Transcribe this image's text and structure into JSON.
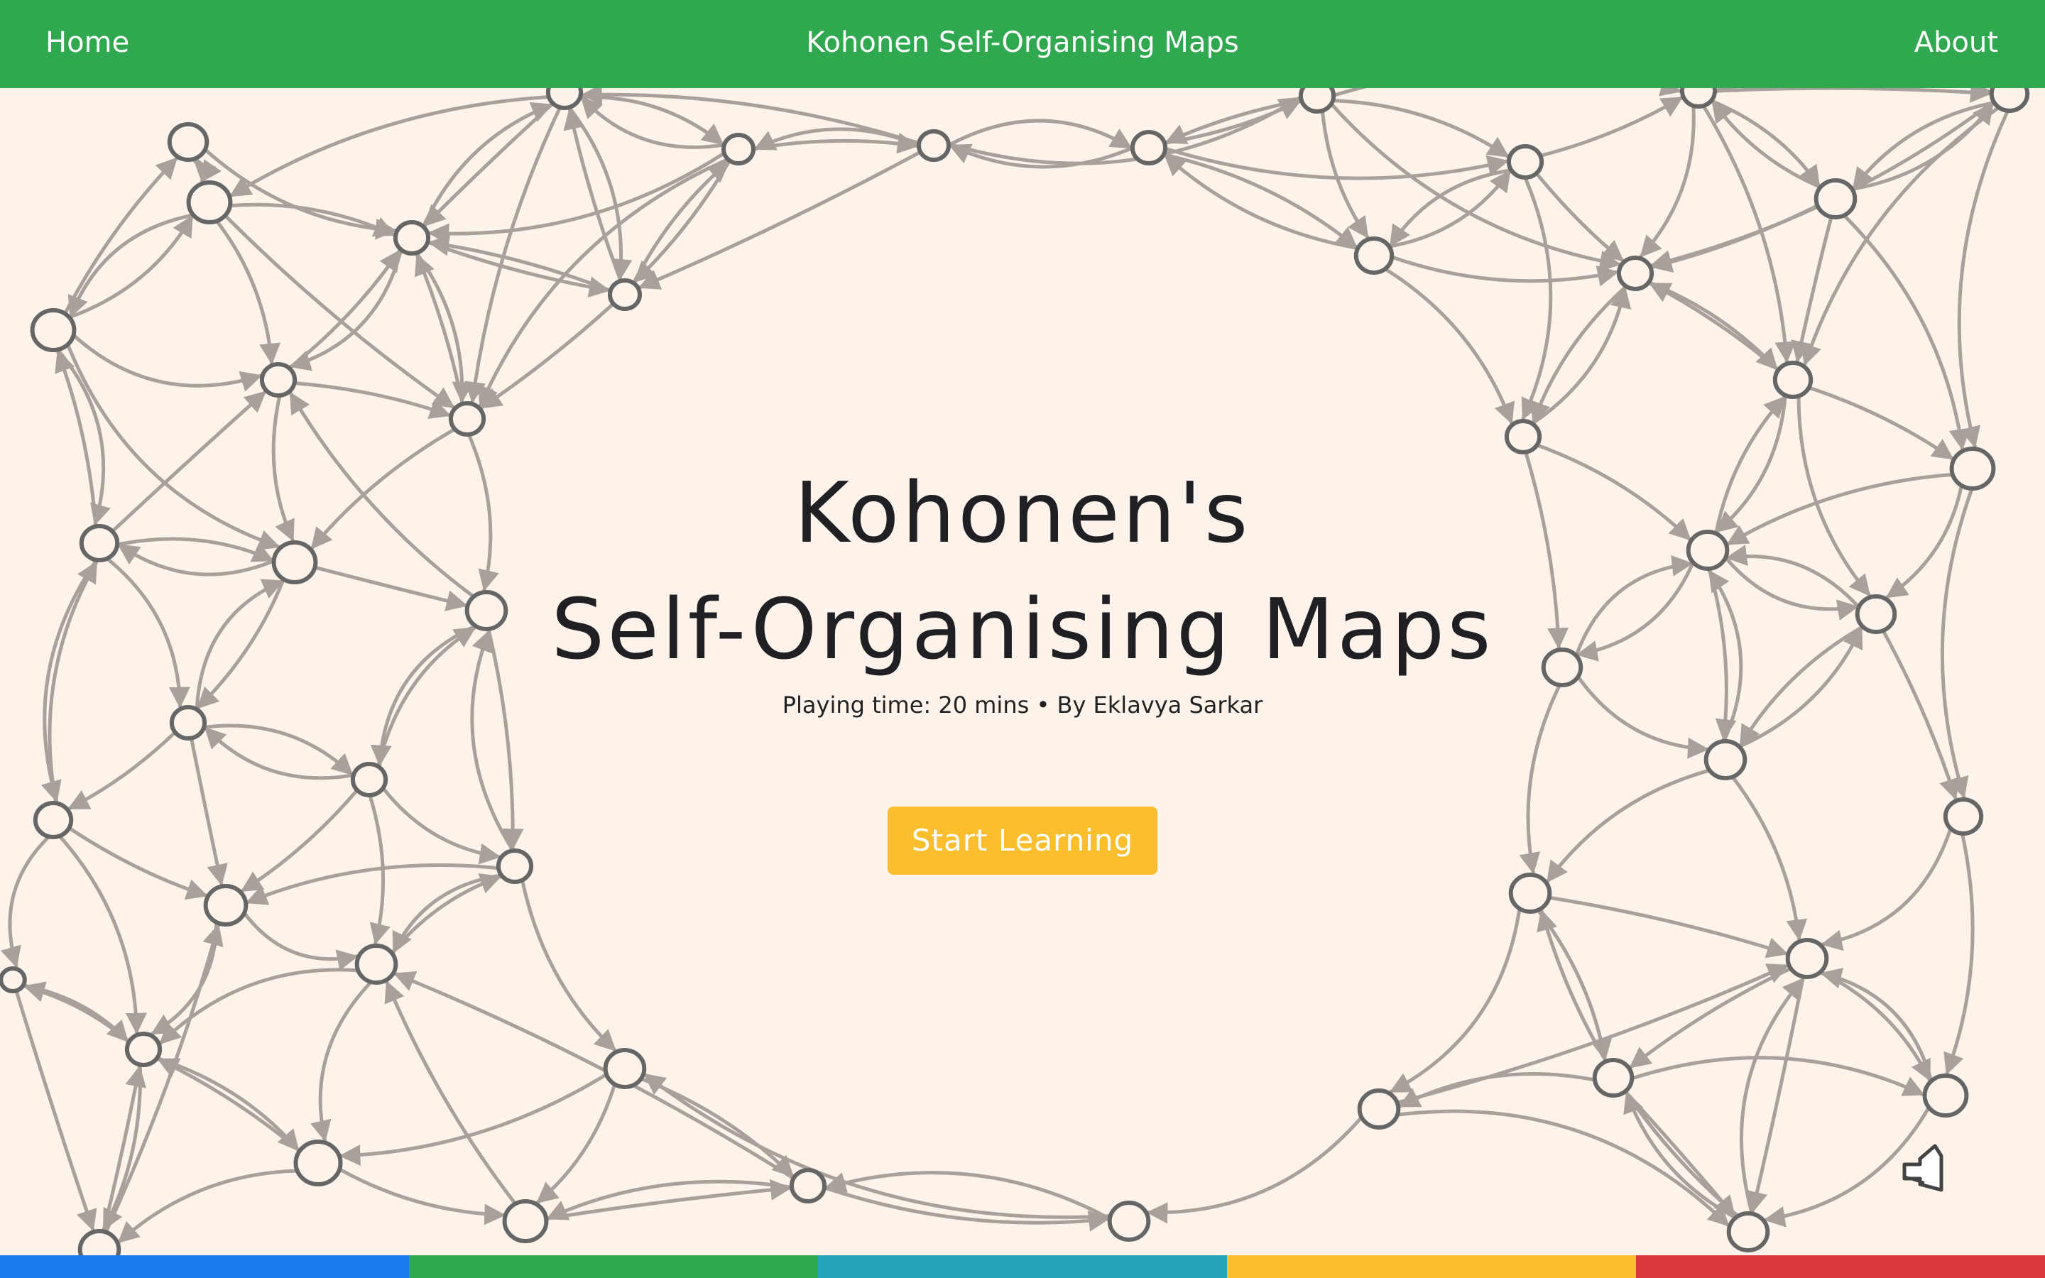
{
  "nav": {
    "home_label": "Home",
    "title": "Kohonen Self-Organising Maps",
    "about_label": "About"
  },
  "hero": {
    "title_line1": "Kohonen's",
    "title_line2": "Self-Organising Maps",
    "meta": "Playing time: 20 mins • By Eklavya Sarkar",
    "cta_label": "Start Learning"
  },
  "icons": {
    "corner": "hand-drawn-pencil-icon"
  },
  "colors": {
    "nav_background": "#2fa84f",
    "page_background": "#fdf3ea",
    "button": "#fbbf2d",
    "network_edges": "#a8a19a",
    "network_nodes": "#666666",
    "footer_segments": [
      "#1a7bf0",
      "#2fa84f",
      "#23a3b8",
      "#fbbf2d",
      "#d8373e"
    ]
  }
}
